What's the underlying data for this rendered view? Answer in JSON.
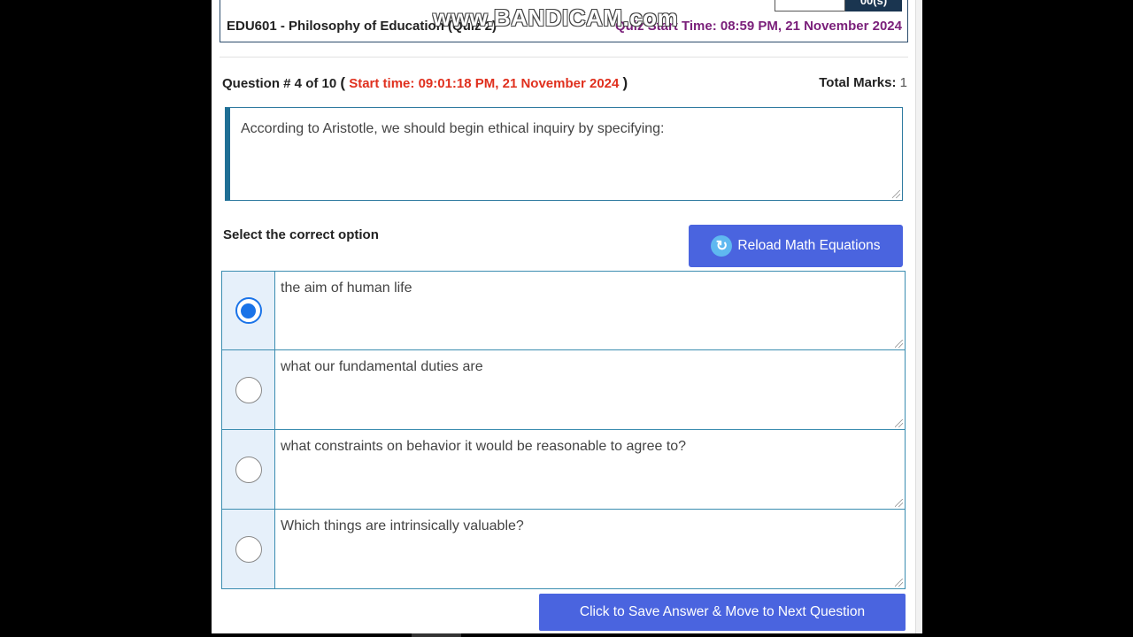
{
  "watermark": "www.BANDICAM.com",
  "header": {
    "timer_value": "00(s)",
    "course_title": "EDU601 - Philosophy of Education (Quiz 2)",
    "quiz_start": "Quiz Start Time: 08:59 PM, 21 November 2024"
  },
  "question": {
    "label": "Question # 4 of 10",
    "open_paren": "(",
    "start_time": "Start time: 09:01:18 PM, 21 November 2024",
    "close_paren": ")",
    "total_marks_label": "Total Marks:",
    "total_marks_value": "1",
    "text": "According to Aristotle, we should begin ethical inquiry by specifying:"
  },
  "select_label": "Select the correct option",
  "reload_button": "Reload Math Equations",
  "options": [
    {
      "text": "the aim of human life",
      "selected": true
    },
    {
      "text": "what our fundamental duties are",
      "selected": false
    },
    {
      "text": "what constraints on behavior it would be reasonable to agree to?",
      "selected": false
    },
    {
      "text": "Which things are intrinsically valuable?",
      "selected": false
    }
  ],
  "next_button": "Click to Save Answer & Move to Next Question",
  "icons": {
    "reload": "reload-icon",
    "radio": "radio-icon"
  },
  "colors": {
    "accent_button": "#4a64df",
    "start_time_red": "#e0301e",
    "quiz_start_purple": "#7a1f7a",
    "radio_selected": "#1a73e8"
  }
}
